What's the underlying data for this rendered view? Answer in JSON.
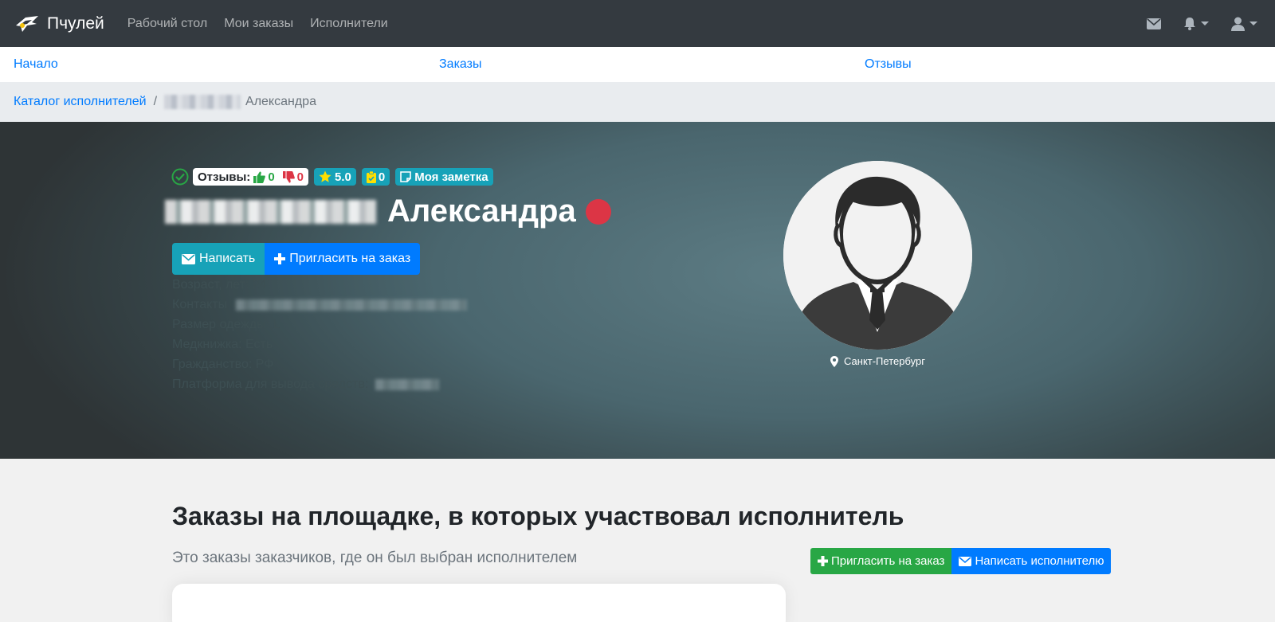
{
  "navbar": {
    "brand": "Пчулей",
    "links": [
      "Рабочий стол",
      "Мои заказы",
      "Исполнители"
    ]
  },
  "subnav": {
    "start": "Начало",
    "orders": "Заказы",
    "reviews": "Отзывы"
  },
  "breadcrumb": {
    "catalog": "Каталог исполнителей",
    "separator": "/",
    "current": "Александра"
  },
  "profile": {
    "reviews_label": "Отзывы:",
    "likes": "0",
    "dislikes": "0",
    "rating": "5.0",
    "tasks_count": "0",
    "note_label": "Моя заметка",
    "name": "Александра",
    "write_button": "Написать",
    "invite_button": "Пригласить на заказ",
    "age": "Возраст, лет: 24",
    "contacts": "Контакты",
    "clothes_size": "Размер одежды: L",
    "med_book": "Медкнижка: Есть",
    "citizenship": "Гражданство: РФ",
    "payout_platform": "Платформа для вывода средств:",
    "city": "Санкт-Петербург"
  },
  "section": {
    "title": "Заказы на площадке, в которых участвовал исполнитель",
    "subtitle": "Это заказы заказчиков, где он был выбран исполнителем",
    "invite_button": "Пригласить на заказ",
    "message_button": "Написать исполнителю"
  },
  "colors": {
    "navbar": "#343a40",
    "link": "#007bff",
    "info": "#17a2b8",
    "success": "#28a745",
    "danger": "#dc3545"
  }
}
